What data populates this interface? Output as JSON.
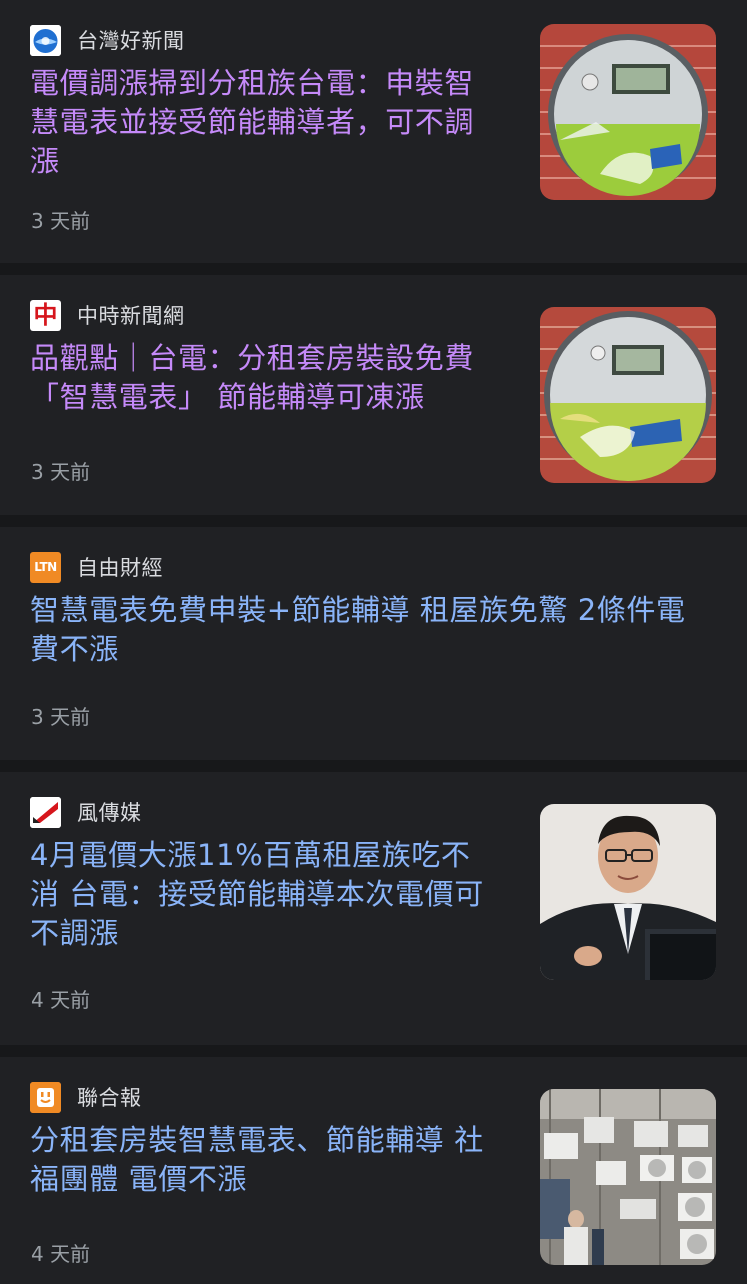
{
  "articles": [
    {
      "source": "台灣好新聞",
      "headline": "電價調漲掃到分租族台電：申裝智慧電表並接受節能輔導者，可不調漲",
      "time": "3 天前",
      "visited": true,
      "thumbnail": "smart-meter-photo"
    },
    {
      "source": "中時新聞網",
      "source_logo_text": "中",
      "headline": "品觀點｜台電：分租套房裝設免費「智慧電表」 節能輔導可凍漲",
      "time": "3 天前",
      "visited": true,
      "thumbnail": "smart-meter-photo"
    },
    {
      "source": "自由財經",
      "source_logo_text": "LTN",
      "headline": "智慧電表免費申裝+節能輔導 租屋族免驚 2條件電費不漲",
      "time": "3 天前",
      "visited": false
    },
    {
      "source": "風傳媒",
      "headline": "4月電價大漲11%百萬租屋族吃不消 台電：接受節能輔導本次電價可不調漲",
      "time": "4 天前",
      "visited": false,
      "thumbnail": "official-speaking-photo"
    },
    {
      "source": "聯合報",
      "headline": "分租套房裝智慧電表、節能輔導 社福團體 電價不漲",
      "time": "4 天前",
      "visited": false,
      "thumbnail": "building-air-conditioners-photo"
    }
  ],
  "colors": {
    "background": "#202124",
    "separator": "#17181a",
    "visited_link": "#c58af9",
    "link": "#8ab4f8",
    "source_text": "#dadce0",
    "time_text": "#9aa0a6"
  }
}
